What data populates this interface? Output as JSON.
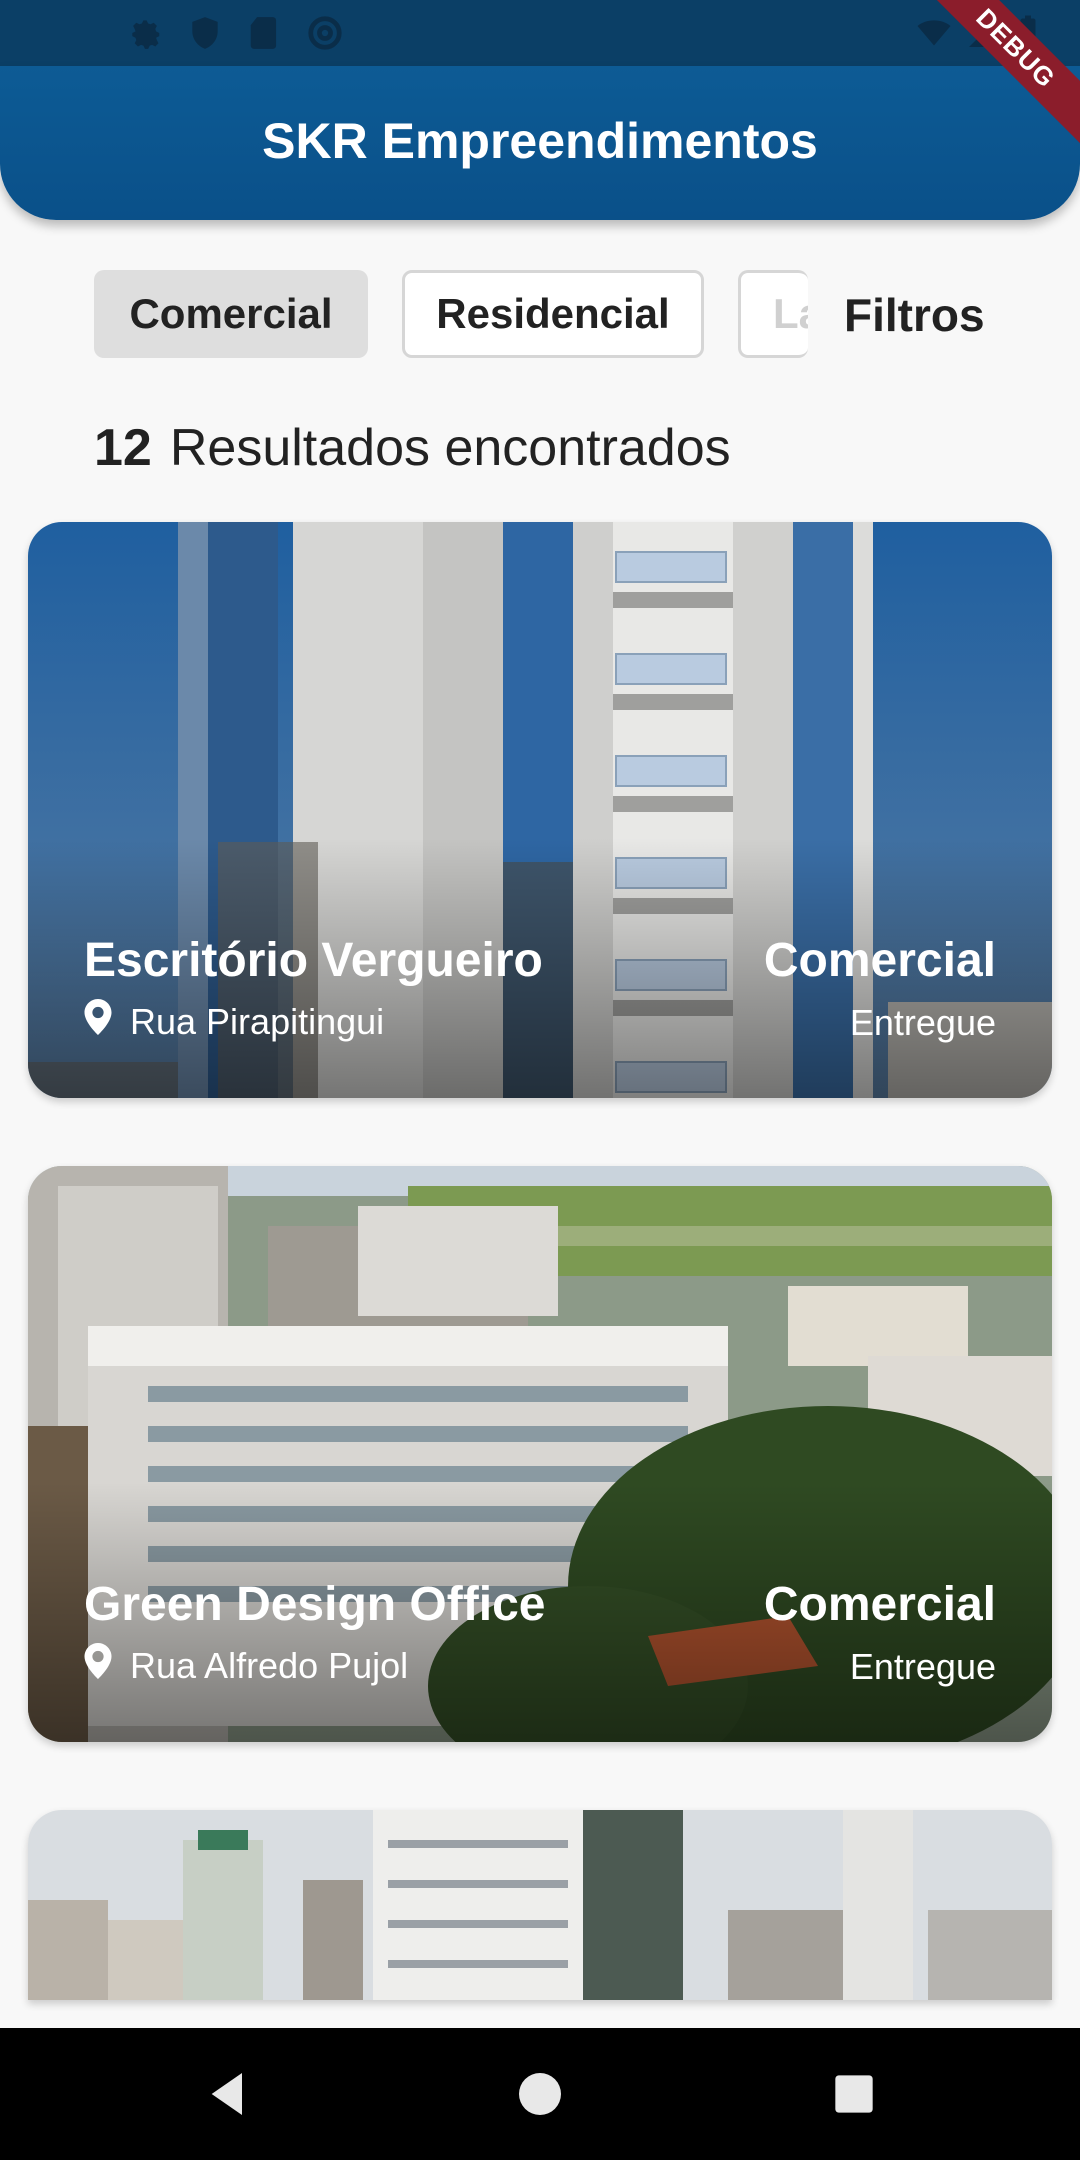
{
  "status_bar": {
    "left_icons": [
      "gear-icon",
      "shield-icon",
      "sd-card-icon",
      "at-sign-icon"
    ],
    "right_icons": [
      "wifi-icon",
      "signal-icon",
      "battery-icon"
    ]
  },
  "app_bar": {
    "title": "SKR Empreendimentos"
  },
  "debug_banner": "DEBUG",
  "filters": {
    "chips": [
      {
        "label": "Comercial",
        "selected": true
      },
      {
        "label": "Residencial",
        "selected": false
      },
      {
        "label": "La",
        "selected": false
      }
    ],
    "filters_label": "Filtros"
  },
  "results": {
    "count": "12",
    "label": "Resultados encontrados"
  },
  "cards": [
    {
      "name": "Escritório Vergueiro",
      "address": "Rua Pirapitingui",
      "type": "Comercial",
      "status": "Entregue"
    },
    {
      "name": "Green Design Office",
      "address": "Rua Alfredo Pujol",
      "type": "Comercial",
      "status": "Entregue"
    }
  ],
  "nav_bar": {
    "buttons": [
      "back-icon",
      "home-icon",
      "recents-icon"
    ]
  },
  "colors": {
    "primary": "#0d5b95",
    "status_bar": "#0b3f66",
    "debug": "#8b1d2b"
  }
}
